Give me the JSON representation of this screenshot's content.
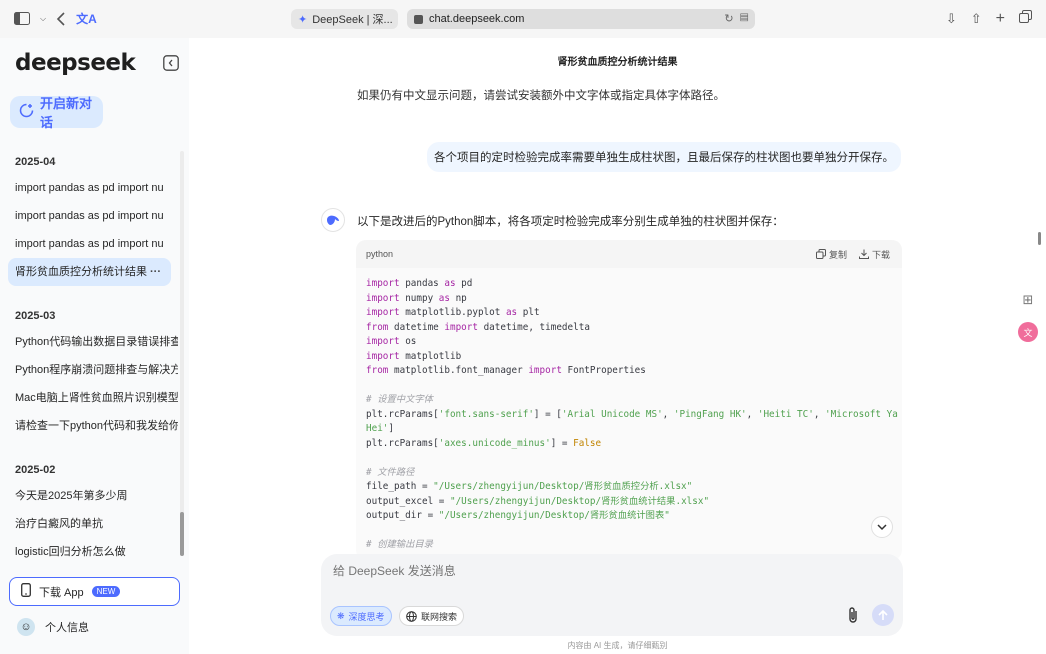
{
  "browser": {
    "tab_title": "DeepSeek | 深...",
    "url": "chat.deepseek.com"
  },
  "sidebar": {
    "logo": "deepseek",
    "new_chat": "开启新对话",
    "groups": [
      {
        "date": "2025-04",
        "items": [
          {
            "label": "import pandas as pd import nu"
          },
          {
            "label": "import pandas as pd import nu"
          },
          {
            "label": "import pandas as pd import nu"
          },
          {
            "label": "肾形贫血质控分析统计结果",
            "active": true,
            "more": "···"
          }
        ]
      },
      {
        "date": "2025-03",
        "items": [
          {
            "label": "Python代码输出数据目录错误排查"
          },
          {
            "label": "Python程序崩溃问题排查与解决方"
          },
          {
            "label": "Mac电脑上肾性贫血照片识别模型"
          },
          {
            "label": "请检查一下python代码和我发给你"
          }
        ]
      },
      {
        "date": "2025-02",
        "items": [
          {
            "label": "今天是2025年第多少周"
          },
          {
            "label": "治疗白癜风的单抗"
          },
          {
            "label": "logistic回归分析怎么做"
          }
        ]
      }
    ],
    "download_app": "下载 App",
    "new_badge": "NEW",
    "profile": "个人信息"
  },
  "main": {
    "title": "肾形贫血质控分析统计结果",
    "prev_text": "如果仍有中文显示问题，请尝试安装额外中文字体或指定具体字体路径。",
    "user_message": "各个项目的定时检验完成率需要单独生成柱状图，且最后保存的柱状图也要单独分开保存。",
    "response_intro": "以下是改进后的Python脚本，将各项定时检验完成率分别生成单独的柱状图并保存：",
    "code_lang": "python",
    "copy_label": "复制",
    "download_label": "下载",
    "composer_placeholder": "给 DeepSeek 发送消息",
    "deep_think": "深度思考",
    "web_search": "联网搜索",
    "footer": "内容由 AI 生成，请仔细甄别"
  }
}
